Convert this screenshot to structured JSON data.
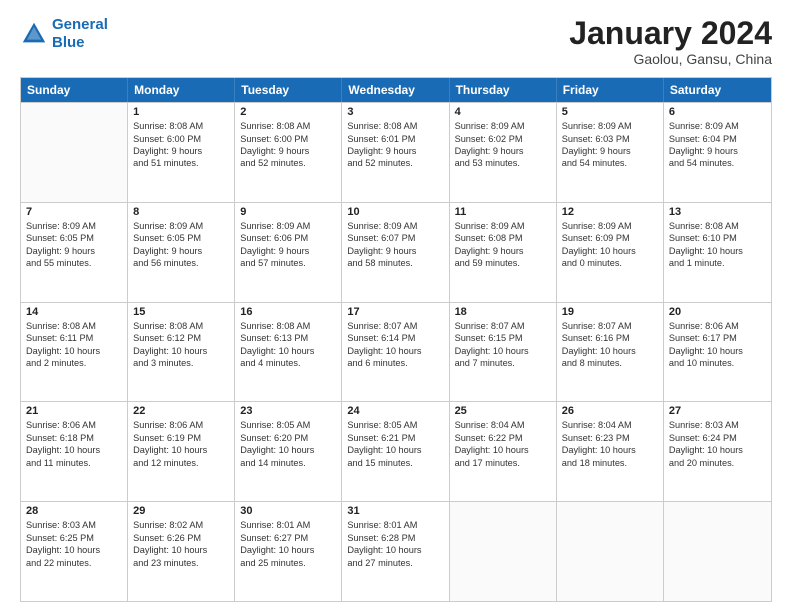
{
  "header": {
    "logo_general": "General",
    "logo_blue": "Blue",
    "main_title": "January 2024",
    "subtitle": "Gaolou, Gansu, China"
  },
  "calendar": {
    "days_of_week": [
      "Sunday",
      "Monday",
      "Tuesday",
      "Wednesday",
      "Thursday",
      "Friday",
      "Saturday"
    ],
    "rows": [
      [
        {
          "day": "",
          "lines": []
        },
        {
          "day": "1",
          "lines": [
            "Sunrise: 8:08 AM",
            "Sunset: 6:00 PM",
            "Daylight: 9 hours",
            "and 51 minutes."
          ]
        },
        {
          "day": "2",
          "lines": [
            "Sunrise: 8:08 AM",
            "Sunset: 6:00 PM",
            "Daylight: 9 hours",
            "and 52 minutes."
          ]
        },
        {
          "day": "3",
          "lines": [
            "Sunrise: 8:08 AM",
            "Sunset: 6:01 PM",
            "Daylight: 9 hours",
            "and 52 minutes."
          ]
        },
        {
          "day": "4",
          "lines": [
            "Sunrise: 8:09 AM",
            "Sunset: 6:02 PM",
            "Daylight: 9 hours",
            "and 53 minutes."
          ]
        },
        {
          "day": "5",
          "lines": [
            "Sunrise: 8:09 AM",
            "Sunset: 6:03 PM",
            "Daylight: 9 hours",
            "and 54 minutes."
          ]
        },
        {
          "day": "6",
          "lines": [
            "Sunrise: 8:09 AM",
            "Sunset: 6:04 PM",
            "Daylight: 9 hours",
            "and 54 minutes."
          ]
        }
      ],
      [
        {
          "day": "7",
          "lines": [
            "Sunrise: 8:09 AM",
            "Sunset: 6:05 PM",
            "Daylight: 9 hours",
            "and 55 minutes."
          ]
        },
        {
          "day": "8",
          "lines": [
            "Sunrise: 8:09 AM",
            "Sunset: 6:05 PM",
            "Daylight: 9 hours",
            "and 56 minutes."
          ]
        },
        {
          "day": "9",
          "lines": [
            "Sunrise: 8:09 AM",
            "Sunset: 6:06 PM",
            "Daylight: 9 hours",
            "and 57 minutes."
          ]
        },
        {
          "day": "10",
          "lines": [
            "Sunrise: 8:09 AM",
            "Sunset: 6:07 PM",
            "Daylight: 9 hours",
            "and 58 minutes."
          ]
        },
        {
          "day": "11",
          "lines": [
            "Sunrise: 8:09 AM",
            "Sunset: 6:08 PM",
            "Daylight: 9 hours",
            "and 59 minutes."
          ]
        },
        {
          "day": "12",
          "lines": [
            "Sunrise: 8:09 AM",
            "Sunset: 6:09 PM",
            "Daylight: 10 hours",
            "and 0 minutes."
          ]
        },
        {
          "day": "13",
          "lines": [
            "Sunrise: 8:08 AM",
            "Sunset: 6:10 PM",
            "Daylight: 10 hours",
            "and 1 minute."
          ]
        }
      ],
      [
        {
          "day": "14",
          "lines": [
            "Sunrise: 8:08 AM",
            "Sunset: 6:11 PM",
            "Daylight: 10 hours",
            "and 2 minutes."
          ]
        },
        {
          "day": "15",
          "lines": [
            "Sunrise: 8:08 AM",
            "Sunset: 6:12 PM",
            "Daylight: 10 hours",
            "and 3 minutes."
          ]
        },
        {
          "day": "16",
          "lines": [
            "Sunrise: 8:08 AM",
            "Sunset: 6:13 PM",
            "Daylight: 10 hours",
            "and 4 minutes."
          ]
        },
        {
          "day": "17",
          "lines": [
            "Sunrise: 8:07 AM",
            "Sunset: 6:14 PM",
            "Daylight: 10 hours",
            "and 6 minutes."
          ]
        },
        {
          "day": "18",
          "lines": [
            "Sunrise: 8:07 AM",
            "Sunset: 6:15 PM",
            "Daylight: 10 hours",
            "and 7 minutes."
          ]
        },
        {
          "day": "19",
          "lines": [
            "Sunrise: 8:07 AM",
            "Sunset: 6:16 PM",
            "Daylight: 10 hours",
            "and 8 minutes."
          ]
        },
        {
          "day": "20",
          "lines": [
            "Sunrise: 8:06 AM",
            "Sunset: 6:17 PM",
            "Daylight: 10 hours",
            "and 10 minutes."
          ]
        }
      ],
      [
        {
          "day": "21",
          "lines": [
            "Sunrise: 8:06 AM",
            "Sunset: 6:18 PM",
            "Daylight: 10 hours",
            "and 11 minutes."
          ]
        },
        {
          "day": "22",
          "lines": [
            "Sunrise: 8:06 AM",
            "Sunset: 6:19 PM",
            "Daylight: 10 hours",
            "and 12 minutes."
          ]
        },
        {
          "day": "23",
          "lines": [
            "Sunrise: 8:05 AM",
            "Sunset: 6:20 PM",
            "Daylight: 10 hours",
            "and 14 minutes."
          ]
        },
        {
          "day": "24",
          "lines": [
            "Sunrise: 8:05 AM",
            "Sunset: 6:21 PM",
            "Daylight: 10 hours",
            "and 15 minutes."
          ]
        },
        {
          "day": "25",
          "lines": [
            "Sunrise: 8:04 AM",
            "Sunset: 6:22 PM",
            "Daylight: 10 hours",
            "and 17 minutes."
          ]
        },
        {
          "day": "26",
          "lines": [
            "Sunrise: 8:04 AM",
            "Sunset: 6:23 PM",
            "Daylight: 10 hours",
            "and 18 minutes."
          ]
        },
        {
          "day": "27",
          "lines": [
            "Sunrise: 8:03 AM",
            "Sunset: 6:24 PM",
            "Daylight: 10 hours",
            "and 20 minutes."
          ]
        }
      ],
      [
        {
          "day": "28",
          "lines": [
            "Sunrise: 8:03 AM",
            "Sunset: 6:25 PM",
            "Daylight: 10 hours",
            "and 22 minutes."
          ]
        },
        {
          "day": "29",
          "lines": [
            "Sunrise: 8:02 AM",
            "Sunset: 6:26 PM",
            "Daylight: 10 hours",
            "and 23 minutes."
          ]
        },
        {
          "day": "30",
          "lines": [
            "Sunrise: 8:01 AM",
            "Sunset: 6:27 PM",
            "Daylight: 10 hours",
            "and 25 minutes."
          ]
        },
        {
          "day": "31",
          "lines": [
            "Sunrise: 8:01 AM",
            "Sunset: 6:28 PM",
            "Daylight: 10 hours",
            "and 27 minutes."
          ]
        },
        {
          "day": "",
          "lines": []
        },
        {
          "day": "",
          "lines": []
        },
        {
          "day": "",
          "lines": []
        }
      ]
    ]
  }
}
